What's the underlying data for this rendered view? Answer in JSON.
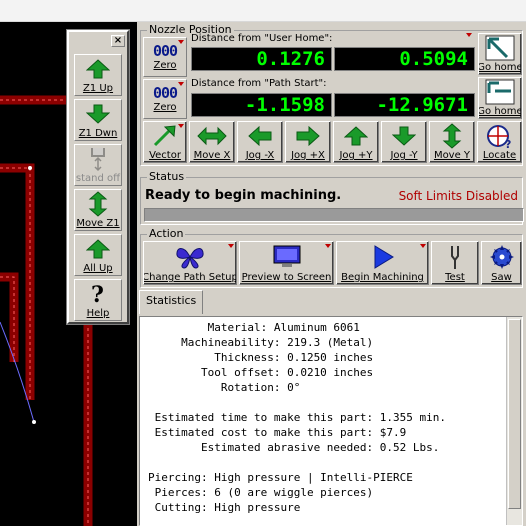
{
  "nozzle_position": {
    "title": "Nozzle Position",
    "user_home_label": "Distance from \"User Home\":",
    "path_start_label": "Distance from \"Path Start\":",
    "user_home_x": "0.1276",
    "user_home_y": "0.5094",
    "path_start_x": "-1.1598",
    "path_start_y": "-12.9671",
    "zero_glyph": "000",
    "zero_label": "Zero",
    "go_home_label": "Go home"
  },
  "jog_buttons": [
    {
      "label": "Vector",
      "icon": "diagonal-arrow-icon"
    },
    {
      "label": "Move X",
      "icon": "horizontal-double-arrow-icon"
    },
    {
      "label": "Jog -X",
      "icon": "arrow-left-icon"
    },
    {
      "label": "Jog +X",
      "icon": "arrow-right-icon"
    },
    {
      "label": "Jog +Y",
      "icon": "arrow-up-icon"
    },
    {
      "label": "Jog -Y",
      "icon": "arrow-down-icon"
    },
    {
      "label": "Move Y",
      "icon": "vertical-double-arrow-icon"
    },
    {
      "label": "Locate",
      "icon": "locate-icon"
    }
  ],
  "status": {
    "title": "Status",
    "message": "Ready to begin machining.",
    "soft_limits": "Soft Limits Disabled",
    "progress": 0
  },
  "action": {
    "title": "Action",
    "buttons": [
      {
        "label": "Change Path Setup",
        "icon": "butterfly-icon"
      },
      {
        "label": "Preview to Screen",
        "icon": "monitor-icon"
      },
      {
        "label": "Begin Machining",
        "icon": "play-icon"
      },
      {
        "label": "Test",
        "icon": "tuning-fork-icon"
      },
      {
        "label": "Saw",
        "icon": "saw-blade-icon"
      }
    ]
  },
  "statistics": {
    "tab_label": "Statistics",
    "lines": [
      "         Material: Aluminum 6061",
      "     Machineability: 219.3 (Metal)",
      "          Thickness: 0.1250 inches",
      "        Tool offset: 0.0210 inches",
      "           Rotation: 0°",
      "",
      " Estimated time to make this part: 1.355 min.",
      " Estimated cost to make this part: $7.9",
      "        Estimated abrasive needed: 0.52 Lbs.",
      "",
      "Piercing: High pressure | Intelli-PIERCE",
      " Pierces: 6 (0 are wiggle pierces)",
      " Cutting: High pressure"
    ]
  },
  "z_toolbar": {
    "close_glyph": "×",
    "buttons": [
      {
        "label": "Z1 Up",
        "icon": "arrow-up-icon",
        "enabled": true
      },
      {
        "label": "Z1 Dwn",
        "icon": "arrow-down-icon",
        "enabled": true
      },
      {
        "label": "stand off",
        "icon": "standoff-icon",
        "enabled": false
      },
      {
        "label": "Move Z1",
        "icon": "vertical-double-arrow-icon",
        "enabled": true
      },
      {
        "label": "All Up",
        "icon": "arrow-up-icon",
        "enabled": true
      },
      {
        "label": "Help",
        "icon": "question-icon",
        "enabled": true
      }
    ]
  },
  "colors": {
    "lcd_text": "#00ff00",
    "path_red": "#b00000",
    "arrow_green": "#1a9a2a",
    "soft_limits": "#b00000"
  }
}
